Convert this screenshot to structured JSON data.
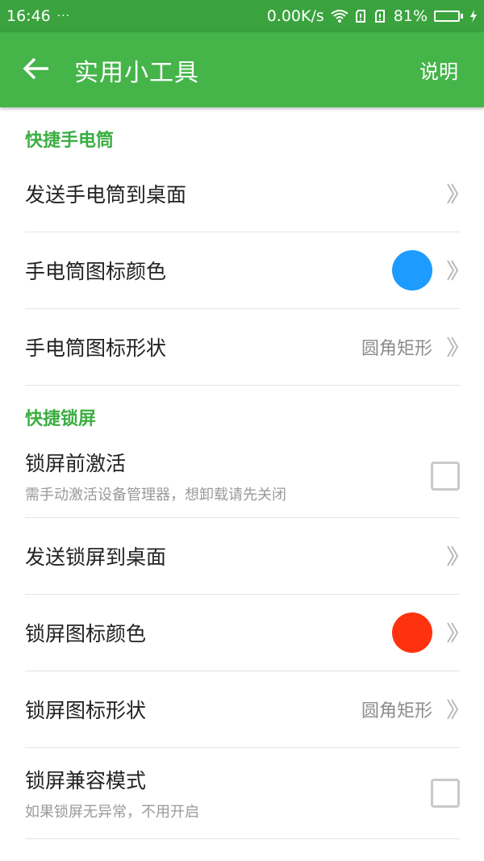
{
  "status_bar": {
    "time": "16:46",
    "dots": "···",
    "network_speed": "0.00K/s",
    "battery_percent": "81%",
    "battery_level": 0.81
  },
  "app_bar": {
    "title": "实用小工具",
    "action": "说明",
    "back_icon": "arrow-left-icon"
  },
  "sections": {
    "flashlight": {
      "title": "快捷手电筒",
      "send_label": "发送手电筒到桌面",
      "color_label": "手电筒图标颜色",
      "color": "#1e9bff",
      "shape_label": "手电筒图标形状",
      "shape_value": "圆角矩形"
    },
    "lock": {
      "title": "快捷锁屏",
      "activate_label": "锁屏前激活",
      "activate_sub": "需手动激活设备管理器，想卸载请先关闭",
      "send_label": "发送锁屏到桌面",
      "color_label": "锁屏图标颜色",
      "color": "#ff3210",
      "shape_label": "锁屏图标形状",
      "shape_value": "圆角矩形",
      "compat_label": "锁屏兼容模式",
      "compat_sub": "如果锁屏无异常，不用开启"
    }
  },
  "colors": {
    "status_bar": "#3aa33e",
    "app_bar": "#45b449",
    "accent": "#3bae41"
  }
}
